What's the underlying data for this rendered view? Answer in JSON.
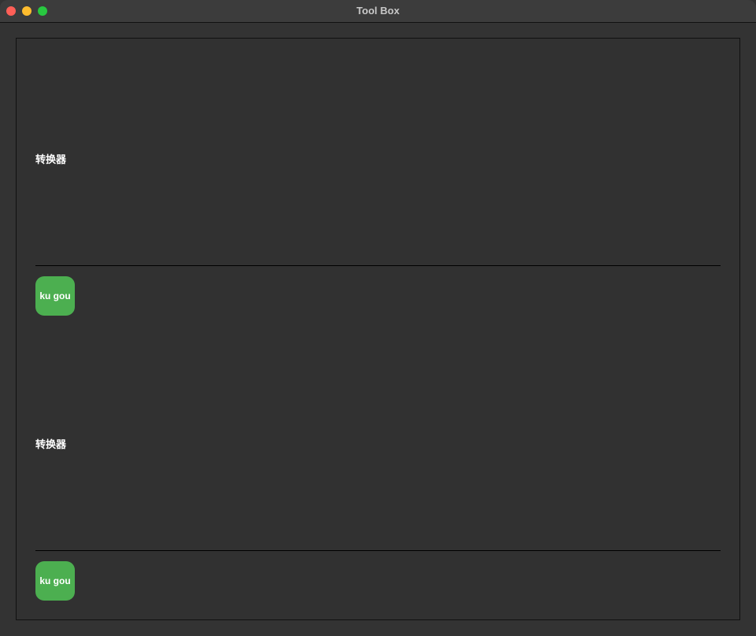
{
  "window": {
    "title": "Tool Box",
    "colors": {
      "close": "#ff5f57",
      "minimize": "#febc2e",
      "zoom": "#28c840",
      "accent": "#4caf50"
    }
  },
  "sections": [
    {
      "label": "转换器",
      "button_label": "ku gou"
    },
    {
      "label": "转换器",
      "button_label": "ku gou"
    }
  ]
}
